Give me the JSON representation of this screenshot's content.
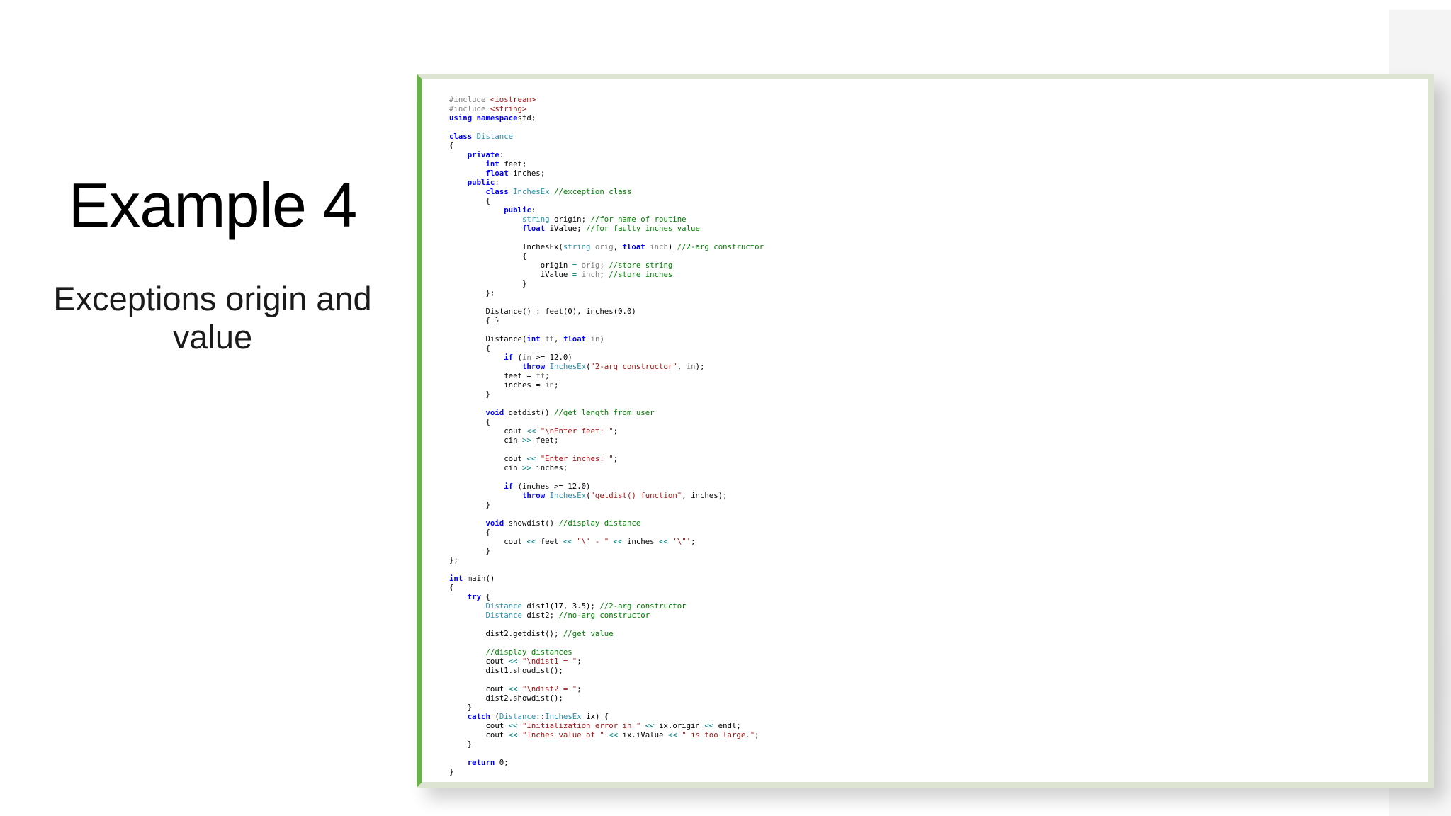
{
  "slide": {
    "title": "Example 4",
    "subtitle": "Exceptions origin and value"
  },
  "code": {
    "language": "C++",
    "lines": [
      [
        [
          "pp",
          "#include "
        ],
        [
          "str",
          "<iostream>"
        ]
      ],
      [
        [
          "pp",
          "#include "
        ],
        [
          "str",
          "<string>"
        ]
      ],
      [
        [
          "kw",
          "using namespace"
        ],
        [
          "",
          "std;"
        ]
      ],
      [],
      [
        [
          "kw",
          "class "
        ],
        [
          "ty",
          "Distance"
        ]
      ],
      [
        [
          "",
          "{"
        ]
      ],
      [
        [
          "",
          "    "
        ],
        [
          "kw",
          "private"
        ],
        [
          "",
          ":"
        ]
      ],
      [
        [
          "",
          "        "
        ],
        [
          "kw",
          "int"
        ],
        [
          "",
          " feet;"
        ]
      ],
      [
        [
          "",
          "        "
        ],
        [
          "kw",
          "float"
        ],
        [
          "",
          " inches;"
        ]
      ],
      [
        [
          "",
          "    "
        ],
        [
          "kw",
          "public"
        ],
        [
          "",
          ":"
        ]
      ],
      [
        [
          "",
          "        "
        ],
        [
          "kw",
          "class "
        ],
        [
          "ty",
          "InchesEx"
        ],
        [
          "",
          " "
        ],
        [
          "cm",
          "//exception class"
        ]
      ],
      [
        [
          "",
          "        {"
        ]
      ],
      [
        [
          "",
          "            "
        ],
        [
          "kw",
          "public"
        ],
        [
          "",
          ":"
        ]
      ],
      [
        [
          "",
          "                "
        ],
        [
          "ty",
          "string"
        ],
        [
          "",
          " origin; "
        ],
        [
          "cm",
          "//for name of routine"
        ]
      ],
      [
        [
          "",
          "                "
        ],
        [
          "kw",
          "float"
        ],
        [
          "",
          " iValue; "
        ],
        [
          "cm",
          "//for faulty inches value"
        ]
      ],
      [],
      [
        [
          "",
          "                InchesEx("
        ],
        [
          "ty",
          "string"
        ],
        [
          "",
          " "
        ],
        [
          "pm",
          "orig"
        ],
        [
          "",
          ", "
        ],
        [
          "kw",
          "float"
        ],
        [
          "",
          " "
        ],
        [
          "pm",
          "inch"
        ],
        [
          "",
          ") "
        ],
        [
          "cm",
          "//2-arg constructor"
        ]
      ],
      [
        [
          "",
          "                {"
        ]
      ],
      [
        [
          "",
          "                    origin "
        ],
        [
          "op",
          "="
        ],
        [
          "",
          " "
        ],
        [
          "pm",
          "orig"
        ],
        [
          "",
          "; "
        ],
        [
          "cm",
          "//store string"
        ]
      ],
      [
        [
          "",
          "                    iValue "
        ],
        [
          "op",
          "="
        ],
        [
          "",
          " "
        ],
        [
          "pm",
          "inch"
        ],
        [
          "",
          "; "
        ],
        [
          "cm",
          "//store inches"
        ]
      ],
      [
        [
          "",
          "                }"
        ]
      ],
      [
        [
          "",
          "        };"
        ]
      ],
      [],
      [
        [
          "",
          "        Distance() : feet(0), inches(0.0)"
        ]
      ],
      [
        [
          "",
          "        { }"
        ]
      ],
      [],
      [
        [
          "",
          "        Distance("
        ],
        [
          "kw",
          "int"
        ],
        [
          "",
          " "
        ],
        [
          "pm",
          "ft"
        ],
        [
          "",
          ", "
        ],
        [
          "kw",
          "float"
        ],
        [
          "",
          " "
        ],
        [
          "pm",
          "in"
        ],
        [
          "",
          ")"
        ]
      ],
      [
        [
          "",
          "        {"
        ]
      ],
      [
        [
          "",
          "            "
        ],
        [
          "kw",
          "if"
        ],
        [
          "",
          " ("
        ],
        [
          "pm",
          "in"
        ],
        [
          "",
          " >= 12.0)"
        ]
      ],
      [
        [
          "",
          "                "
        ],
        [
          "kw",
          "throw"
        ],
        [
          "",
          " "
        ],
        [
          "ty",
          "InchesEx"
        ],
        [
          "",
          "("
        ],
        [
          "str",
          "\"2-arg constructor\""
        ],
        [
          "",
          ", "
        ],
        [
          "pm",
          "in"
        ],
        [
          "",
          ");"
        ]
      ],
      [
        [
          "",
          "            feet = "
        ],
        [
          "pm",
          "ft"
        ],
        [
          "",
          ";"
        ]
      ],
      [
        [
          "",
          "            inches = "
        ],
        [
          "pm",
          "in"
        ],
        [
          "",
          ";"
        ]
      ],
      [
        [
          "",
          "        }"
        ]
      ],
      [],
      [
        [
          "",
          "        "
        ],
        [
          "kw",
          "void"
        ],
        [
          "",
          " getdist() "
        ],
        [
          "cm",
          "//get length from user"
        ]
      ],
      [
        [
          "",
          "        {"
        ]
      ],
      [
        [
          "",
          "            cout "
        ],
        [
          "op",
          "<<"
        ],
        [
          "",
          " "
        ],
        [
          "str",
          "\"\\nEnter feet: \""
        ],
        [
          "",
          ";"
        ]
      ],
      [
        [
          "",
          "            cin "
        ],
        [
          "op",
          ">>"
        ],
        [
          "",
          " feet;"
        ]
      ],
      [],
      [
        [
          "",
          "            cout "
        ],
        [
          "op",
          "<<"
        ],
        [
          "",
          " "
        ],
        [
          "str",
          "\"Enter inches: \""
        ],
        [
          "",
          ";"
        ]
      ],
      [
        [
          "",
          "            cin "
        ],
        [
          "op",
          ">>"
        ],
        [
          "",
          " inches;"
        ]
      ],
      [],
      [
        [
          "",
          "            "
        ],
        [
          "kw",
          "if"
        ],
        [
          "",
          " (inches >= 12.0)"
        ]
      ],
      [
        [
          "",
          "                "
        ],
        [
          "kw",
          "throw"
        ],
        [
          "",
          " "
        ],
        [
          "ty",
          "InchesEx"
        ],
        [
          "",
          "("
        ],
        [
          "str",
          "\"getdist() function\""
        ],
        [
          "",
          ", inches);"
        ]
      ],
      [
        [
          "",
          "        }"
        ]
      ],
      [],
      [
        [
          "",
          "        "
        ],
        [
          "kw",
          "void"
        ],
        [
          "",
          " showdist() "
        ],
        [
          "cm",
          "//display distance"
        ]
      ],
      [
        [
          "",
          "        {"
        ]
      ],
      [
        [
          "",
          "            cout "
        ],
        [
          "op",
          "<<"
        ],
        [
          "",
          " feet "
        ],
        [
          "op",
          "<<"
        ],
        [
          "",
          " "
        ],
        [
          "str",
          "\"\\' - \""
        ],
        [
          "",
          " "
        ],
        [
          "op",
          "<<"
        ],
        [
          "",
          " inches "
        ],
        [
          "op",
          "<<"
        ],
        [
          "",
          " "
        ],
        [
          "str",
          "'\\\"'"
        ],
        [
          "",
          ";"
        ]
      ],
      [
        [
          "",
          "        }"
        ]
      ],
      [
        [
          "",
          "};"
        ]
      ],
      [],
      [
        [
          "kw",
          "int"
        ],
        [
          "",
          " main()"
        ]
      ],
      [
        [
          "",
          "{"
        ]
      ],
      [
        [
          "",
          "    "
        ],
        [
          "kw",
          "try"
        ],
        [
          "",
          " {"
        ]
      ],
      [
        [
          "",
          "        "
        ],
        [
          "ty",
          "Distance"
        ],
        [
          "",
          " dist1(17, 3.5); "
        ],
        [
          "cm",
          "//2-arg constructor"
        ]
      ],
      [
        [
          "",
          "        "
        ],
        [
          "ty",
          "Distance"
        ],
        [
          "",
          " dist2; "
        ],
        [
          "cm",
          "//no-arg constructor"
        ]
      ],
      [],
      [
        [
          "",
          "        dist2.getdist(); "
        ],
        [
          "cm",
          "//get value"
        ]
      ],
      [],
      [
        [
          "",
          "        "
        ],
        [
          "cm",
          "//display distances"
        ]
      ],
      [
        [
          "",
          "        cout "
        ],
        [
          "op",
          "<<"
        ],
        [
          "",
          " "
        ],
        [
          "str",
          "\"\\ndist1 = \""
        ],
        [
          "",
          ";"
        ]
      ],
      [
        [
          "",
          "        dist1.showdist();"
        ]
      ],
      [],
      [
        [
          "",
          "        cout "
        ],
        [
          "op",
          "<<"
        ],
        [
          "",
          " "
        ],
        [
          "str",
          "\"\\ndist2 = \""
        ],
        [
          "",
          ";"
        ]
      ],
      [
        [
          "",
          "        dist2.showdist();"
        ]
      ],
      [
        [
          "",
          "    }"
        ]
      ],
      [
        [
          "",
          "    "
        ],
        [
          "kw",
          "catch"
        ],
        [
          "",
          " ("
        ],
        [
          "ty",
          "Distance"
        ],
        [
          "",
          "::"
        ],
        [
          "ty",
          "InchesEx"
        ],
        [
          "",
          " ix) {"
        ]
      ],
      [
        [
          "",
          "        cout "
        ],
        [
          "op",
          "<<"
        ],
        [
          "",
          " "
        ],
        [
          "str",
          "\"Initialization error in \""
        ],
        [
          "",
          " "
        ],
        [
          "op",
          "<<"
        ],
        [
          "",
          " ix.origin "
        ],
        [
          "op",
          "<<"
        ],
        [
          "",
          " endl;"
        ]
      ],
      [
        [
          "",
          "        cout "
        ],
        [
          "op",
          "<<"
        ],
        [
          "",
          " "
        ],
        [
          "str",
          "\"Inches value of \""
        ],
        [
          "",
          " "
        ],
        [
          "op",
          "<<"
        ],
        [
          "",
          " ix.iValue "
        ],
        [
          "op",
          "<<"
        ],
        [
          "",
          " "
        ],
        [
          "str",
          "\" is too large.\""
        ],
        [
          "",
          ";"
        ]
      ],
      [
        [
          "",
          "    }"
        ]
      ],
      [],
      [
        [
          "",
          "    "
        ],
        [
          "kw",
          "return"
        ],
        [
          "",
          " 0;"
        ]
      ],
      [
        [
          "",
          "}"
        ]
      ]
    ]
  }
}
